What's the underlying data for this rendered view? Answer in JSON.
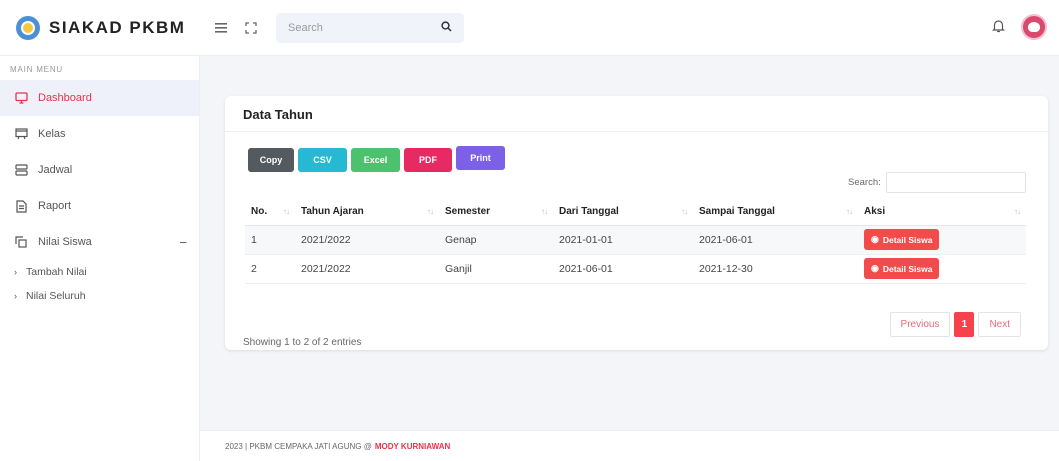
{
  "app": {
    "title": "SIAKAD PKBM"
  },
  "header": {
    "search_placeholder": "Search"
  },
  "sidebar": {
    "section_label": "MAIN MENU",
    "items": [
      {
        "label": "Dashboard",
        "icon": "monitor-icon",
        "active": true
      },
      {
        "label": "Kelas",
        "icon": "classroom-icon"
      },
      {
        "label": "Jadwal",
        "icon": "schedule-icon"
      },
      {
        "label": "Raport",
        "icon": "file-icon"
      },
      {
        "label": "Nilai Siswa",
        "icon": "copy-icon",
        "expanded": true
      }
    ],
    "sub_items": [
      {
        "label": "Tambah Nilai"
      },
      {
        "label": "Nilai Seluruh"
      }
    ]
  },
  "card": {
    "title": "Data Tahun",
    "buttons": {
      "copy": "Copy",
      "csv": "CSV",
      "excel": "Excel",
      "pdf": "PDF",
      "print": "Print"
    },
    "search_label": "Search:",
    "table": {
      "headers": [
        "No.",
        "Tahun Ajaran",
        "Semester",
        "Dari Tanggal",
        "Sampai Tanggal",
        "Aksi"
      ],
      "rows": [
        {
          "no": "1",
          "tahun": "2021/2022",
          "semester": "Genap",
          "dari": "2021-01-01",
          "sampai": "2021-06-01",
          "aksi": "Detail Siswa"
        },
        {
          "no": "2",
          "tahun": "2021/2022",
          "semester": "Ganjil",
          "dari": "2021-06-01",
          "sampai": "2021-12-30",
          "aksi": "Detail Siswa"
        }
      ]
    },
    "info": "Showing 1 to 2 of 2 entries",
    "pager": {
      "previous": "Previous",
      "current": "1",
      "next": "Next"
    }
  },
  "footer": {
    "text": "2023 | PKBM CEMPAKA JATI AGUNG @",
    "author": "MODY KURNIAWAN"
  },
  "colors": {
    "accent": "#e8334a",
    "detail_button": "#f24b4b"
  }
}
